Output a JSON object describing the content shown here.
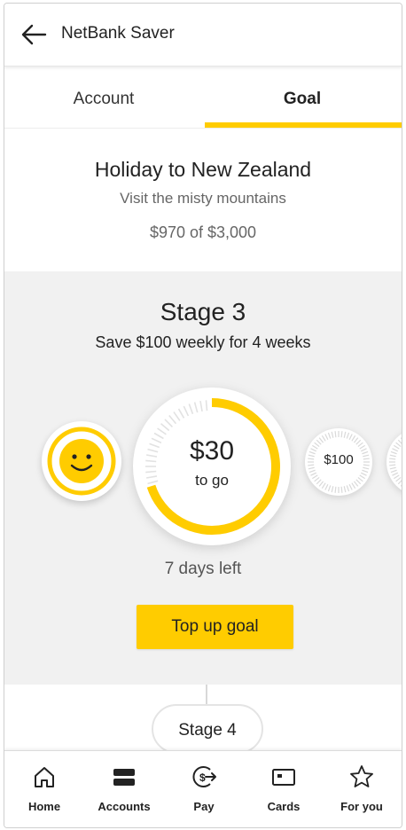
{
  "header": {
    "title": "NetBank Saver"
  },
  "tabs": [
    {
      "label": "Account",
      "selected": false
    },
    {
      "label": "Goal",
      "selected": true
    }
  ],
  "goal": {
    "title": "Holiday to New Zealand",
    "subtitle": "Visit the misty mountains",
    "amount": "$970 of $3,000"
  },
  "stage": {
    "title": "Stage 3",
    "subtitle": "Save $100 weekly for 4 weeks",
    "current_amount": "$30",
    "current_caption": "to go",
    "progress_fraction": 0.7,
    "next_amount": "$100",
    "days_left": "7 days left",
    "topup_label": "Top up goal",
    "next_stage_label": "Stage 4"
  },
  "colors": {
    "accent": "#ffcc00",
    "stage_background": "#f1f1f1"
  },
  "nav": [
    {
      "label": "Home",
      "icon": "home-icon"
    },
    {
      "label": "Accounts",
      "icon": "accounts-icon"
    },
    {
      "label": "Pay",
      "icon": "pay-icon"
    },
    {
      "label": "Cards",
      "icon": "cards-icon"
    },
    {
      "label": "For you",
      "icon": "star-icon"
    }
  ]
}
